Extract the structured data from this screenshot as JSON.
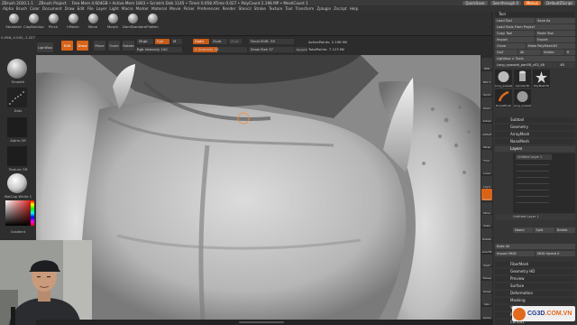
{
  "window": {
    "title": "ZBrush 2020.1.1",
    "project": "ZBrush Project",
    "stats": "Free Mem 4.604GB • Active Mem 1803 • Scratch Disk 1145 • Timer 0.058 ATime 0.027 • PolyCount 2.198 MP • MeshCount 1"
  },
  "menubar": [
    "Alpha",
    "Brush",
    "Color",
    "Document",
    "Draw",
    "Edit",
    "File",
    "Layer",
    "Light",
    "Macro",
    "Marker",
    "Material",
    "Movie",
    "Picker",
    "Preferences",
    "Render",
    "Stencil",
    "Stroke",
    "Texture",
    "Tool",
    "Transform",
    "Zplugin",
    "Zscript",
    "Help"
  ],
  "topright": {
    "quicksave": "QuickSave",
    "seethrough": "See-through 0",
    "menus": "Menus",
    "script": "DefaultZScript"
  },
  "brushes": [
    "Standard",
    "ClayBuildup",
    "Pinch",
    "hPolish",
    "Move",
    "Morph",
    "DamStandard",
    "Flatten"
  ],
  "toolrow": {
    "projection": "Projection Master",
    "lightbox": "LightBox",
    "edit": "Edit",
    "draw": "Draw",
    "move": "Move",
    "scale": "Scale",
    "rotate": "Rotate",
    "mrgb": "Mrgb",
    "rgb": "Rgb",
    "m": "M",
    "zadd": "Zadd",
    "zsub": "Zsub",
    "zcut": "Zcut",
    "rgb_intensity": "Rgb Intensity 100",
    "z_intensity": "Z Intensity 16",
    "focal_shift": "Focal Shift -55",
    "draw_size": "Draw Size 37",
    "dynamic": "Dynamic",
    "active_points": "ActivePoints: 2.198 Mil",
    "total_points": "TotalPoints: 7.123 Mil"
  },
  "lefttray": {
    "coords": "0.596,-0.092,-1.207",
    "smooth": "Smooth",
    "dots": "Dots",
    "alpha_off": "Alpha Off",
    "texture_off": "Texture Off",
    "matcap": "MatCap White C",
    "gradient": "Gradient"
  },
  "rightstrip": [
    "BPR",
    "SPix 3",
    "Scroll",
    "Zoom",
    "Actual",
    "AAHalf",
    "Persp",
    "Floor",
    "Local",
    "L.Sym",
    "Frame",
    "Move",
    "Scale",
    "Rotate",
    "Line Fill",
    "PolyF",
    "Transp",
    "Ghost",
    "Solo",
    "Xpose"
  ],
  "palette": {
    "header": "Tool",
    "load_tool": "Load Tool",
    "save_as": "Save As",
    "load_from_project": "Load Tools From Project",
    "copy_tool": "Copy Tool",
    "paste_tool": "Paste Tool",
    "import": "Import",
    "export": "Export",
    "clone": "Clone",
    "make_polymesh": "Make PolyMesh3D",
    "goz": "GoZ",
    "all": "All",
    "visible": "Visible",
    "r": "R",
    "lightbox_tools": "Lightbox > Tools",
    "current_tool": "Long_quaseat_pan08_v03_48",
    "current_count": "48",
    "thumbs": [
      "Long_quaseat_pa",
      "Cylinder3D",
      "PolyMesh3D",
      "SimpleBrush",
      "Long_quaseat_pa"
    ],
    "sections": [
      "Subtool",
      "Geometry",
      "ArrayMesh",
      "NanoMesh",
      "Layers"
    ],
    "layer_name": "Untitled Layer 1",
    "layer_name2": "Untitled Layer 1",
    "layer_buttons": [
      "Name",
      "Split",
      "Delete"
    ],
    "bake_all": "Bake All",
    "import_mdd": "Import MDD",
    "mdd_speed": "MDD Speed 0",
    "sections2": [
      "FiberMesh",
      "Geometry HD",
      "Preview",
      "Surface",
      "Deformation",
      "Masking",
      "Visibility",
      "Polygroups",
      "Contact"
    ]
  },
  "watermark": {
    "brand": "CG3D",
    "domain": ".COM.VN"
  }
}
